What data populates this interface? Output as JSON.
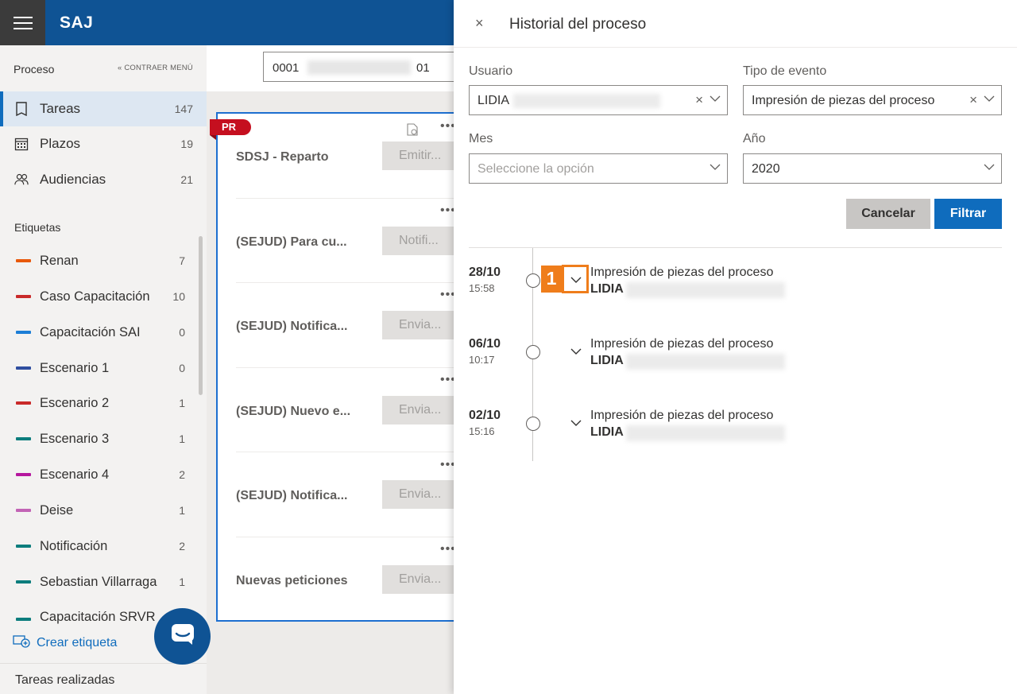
{
  "app": {
    "brand": "SAJ"
  },
  "sidebar": {
    "header": "Proceso",
    "collapse_label": "CONTRAER MENÚ",
    "nav": [
      {
        "label": "Tareas",
        "count": "147",
        "icon": "tasks-icon"
      },
      {
        "label": "Plazos",
        "count": "19",
        "icon": "calendar-icon"
      },
      {
        "label": "Audiencias",
        "count": "21",
        "icon": "people-icon"
      }
    ],
    "tags_header": "Etiquetas",
    "tags": [
      {
        "label": "Renan",
        "count": "7",
        "color": "#e8590c"
      },
      {
        "label": "Caso Capacitación",
        "count": "10",
        "color": "#c92a2a"
      },
      {
        "label": "Capacitación SAI",
        "count": "0",
        "color": "#1c7ed6"
      },
      {
        "label": "Escenario 1",
        "count": "0",
        "color": "#2f4ea0"
      },
      {
        "label": "Escenario 2",
        "count": "1",
        "color": "#c92a2a"
      },
      {
        "label": "Escenario 3",
        "count": "1",
        "color": "#0c7d7d"
      },
      {
        "label": "Escenario 4",
        "count": "2",
        "color": "#b5179e"
      },
      {
        "label": "Deise",
        "count": "1",
        "color": "#c264b5"
      },
      {
        "label": "Notificación",
        "count": "2",
        "color": "#0c7d7d"
      },
      {
        "label": "Sebastian Villarraga",
        "count": "1",
        "color": "#0c7d7d"
      },
      {
        "label": "Capacitación SRVR",
        "count": "",
        "color": "#0c7d7d"
      }
    ],
    "create_tag": "Crear etiqueta",
    "footer": "Tareas realizadas"
  },
  "middle": {
    "search_value_start": "0001",
    "search_value_end": "01",
    "badge": "PR",
    "tasks": [
      {
        "title": "SDSJ - Reparto",
        "action": "Emitir..."
      },
      {
        "title": "(SEJUD) Para cu...",
        "action": "Notifi..."
      },
      {
        "title": "(SEJUD) Notifica...",
        "action": "Envia..."
      },
      {
        "title": "(SEJUD) Nuevo e...",
        "action": "Envia..."
      },
      {
        "title": "(SEJUD) Notifica...",
        "action": "Envia..."
      },
      {
        "title": "Nuevas peticiones",
        "action": "Envia..."
      }
    ],
    "more": "•••"
  },
  "panel": {
    "title": "Historial del proceso",
    "close": "×",
    "filters": {
      "usuario_label": "Usuario",
      "usuario_value": "LIDIA",
      "tipo_label": "Tipo de evento",
      "tipo_value": "Impresión de piezas del proceso",
      "mes_label": "Mes",
      "mes_placeholder": "Seleccione la opción",
      "anio_label": "Año",
      "anio_value": "2020"
    },
    "cancel": "Cancelar",
    "filter": "Filtrar",
    "events": [
      {
        "date": "28/10",
        "time": "15:58",
        "type": "Impresión de piezas del proceso",
        "user": "LIDIA"
      },
      {
        "date": "06/10",
        "time": "10:17",
        "type": "Impresión de piezas del proceso",
        "user": "LIDIA"
      },
      {
        "date": "02/10",
        "time": "15:16",
        "type": "Impresión de piezas del proceso",
        "user": "LIDIA"
      }
    ],
    "step_marker": "1"
  }
}
